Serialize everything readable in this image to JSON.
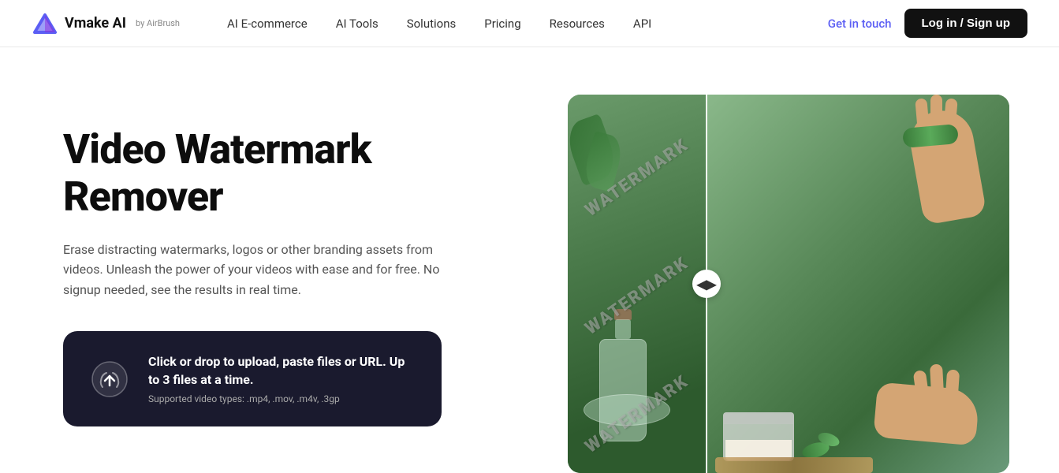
{
  "navbar": {
    "logo_text": "Vmake AI",
    "logo_by": "by AirBrush",
    "nav_links": [
      {
        "label": "AI E-commerce",
        "id": "ai-ecommerce"
      },
      {
        "label": "AI Tools",
        "id": "ai-tools"
      },
      {
        "label": "Solutions",
        "id": "solutions"
      },
      {
        "label": "Pricing",
        "id": "pricing"
      },
      {
        "label": "Resources",
        "id": "resources"
      },
      {
        "label": "API",
        "id": "api"
      }
    ],
    "get_in_touch": "Get in touch",
    "login_btn": "Log in / Sign up"
  },
  "hero": {
    "title": "Video Watermark Remover",
    "description": "Erase distracting watermarks, logos or other branding assets from videos. Unleash the power of your videos with ease and for free. No signup needed, see the results in real time.",
    "upload_main": "Click or drop to upload, paste files or URL. Up to 3 files at a time.",
    "upload_sub": "Supported video types: .mp4, .mov, .m4v, .3gp"
  },
  "comparison": {
    "watermark_text": "WATERMARK",
    "divider_icon": "◀▶"
  }
}
